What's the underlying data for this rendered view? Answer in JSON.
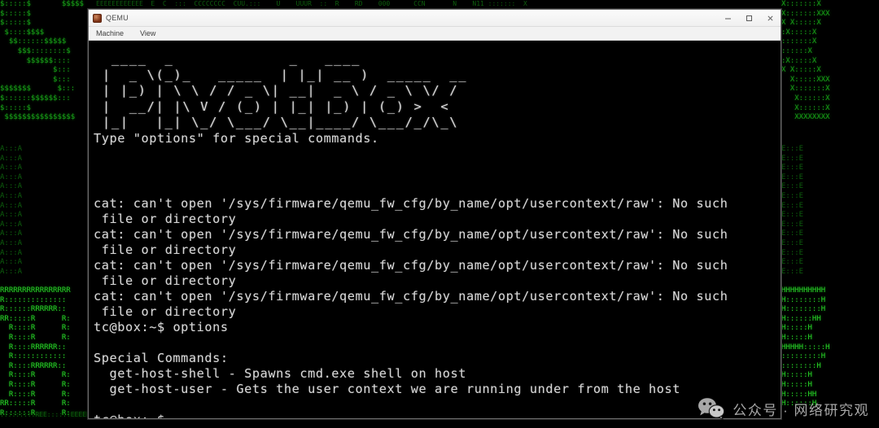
{
  "window": {
    "title": "QEMU",
    "icon": "qemu-app-icon",
    "menus": [
      {
        "label": "Machine",
        "name": "menu-machine"
      },
      {
        "label": "View",
        "name": "menu-view"
      }
    ],
    "controls": [
      {
        "label": "Minimize",
        "name": "minimize-button",
        "icon": "minimize-icon"
      },
      {
        "label": "Maximize",
        "name": "maximize-button",
        "icon": "maximize-icon"
      },
      {
        "label": "Close",
        "name": "close-button",
        "icon": "close-icon"
      }
    ]
  },
  "terminal": {
    "banner": [
      "  ____  _             _   ____",
      " |  _ \\(_)_   _____  | |_| __ )  _____  __",
      " | |_) | \\ \\ / / _ \\| __|  _ \\ / _ \\ \\/ /",
      " |  __/| |\\ V / (_) | |_| |_) | (_) >  <",
      " |_|   |_| \\_/ \\___/ \\__|____/ \\___/_/\\_\\"
    ],
    "hint": "Type \"options\" for special commands.",
    "errors": [
      {
        "line1": "cat: can't open '/sys/firmware/qemu_fw_cfg/by_name/opt/usercontext/raw': No such",
        "line2": " file or directory"
      },
      {
        "line1": "cat: can't open '/sys/firmware/qemu_fw_cfg/by_name/opt/usercontext/raw': No such",
        "line2": " file or directory"
      },
      {
        "line1": "cat: can't open '/sys/firmware/qemu_fw_cfg/by_name/opt/usercontext/raw': No such",
        "line2": " file or directory"
      },
      {
        "line1": "cat: can't open '/sys/firmware/qemu_fw_cfg/by_name/opt/usercontext/raw': No such",
        "line2": " file or directory"
      }
    ],
    "prompt": "tc@box:~$ ",
    "entered_command": "options",
    "options_heading": "Special Commands:",
    "options": [
      "  get-host-shell - Spawns cmd.exe shell on host",
      "  get-host-user - Gets the user context we are running under from the host"
    ],
    "final_prompt": "tc@box:~$ ",
    "cursor": "_"
  },
  "background": {
    "left_top": "$:::::$       $$$$$\n$:::::$\n$:::::$\n $::::$$$$\n  $$::::::$$$$$\n    $$$::::::::$\n      $$$$$$::::\n            $:::\n            $:::\n$$$$$$$      $:::\n$::::::$$$$$$:::\n$:::::$\n $$$$$$$$$$$$$$$$",
    "left_bottom": "RRRRRRRRRRRRRRRR\nR::::::::::::::\nR::::::RRRRRR::\nRR:::::R      R:\n  R::::R      R:\n  R::::R      R:\n  R::::RRRRRR::\n  R::::::::::::\n  R::::RRRRRR::\n  R::::R      R:\n  R::::R      R:\n  R::::R      R:\nRR:::::R      R:\nR::::::R      R:",
    "right_top": "X:::::::X\nX:::::::XXX\nX X:::::X\n:X:::::X\n:::::::X\n::::::X\n:X:::::X\nX X:::::X\n  X:::::XXX\n  X:::::::X\n   X::::::X\n   X::::::X\n   XXXXXXXX",
    "right_bottom": "HHHHHHHHHH\nH::::::::H\nH::::::::H\nH::::::HH\nH:::::H\nH:::::H\nHHHHH:::::H\n:::::::::H\n::::::::H\nH:::::H\nH:::::H\nH:::::HH\nH::::::H",
    "color": "#18a018",
    "dim_color": "#0d5f0d"
  },
  "watermark": {
    "icon": "wechat-icon",
    "text": "公众号 · 网络研究观"
  }
}
